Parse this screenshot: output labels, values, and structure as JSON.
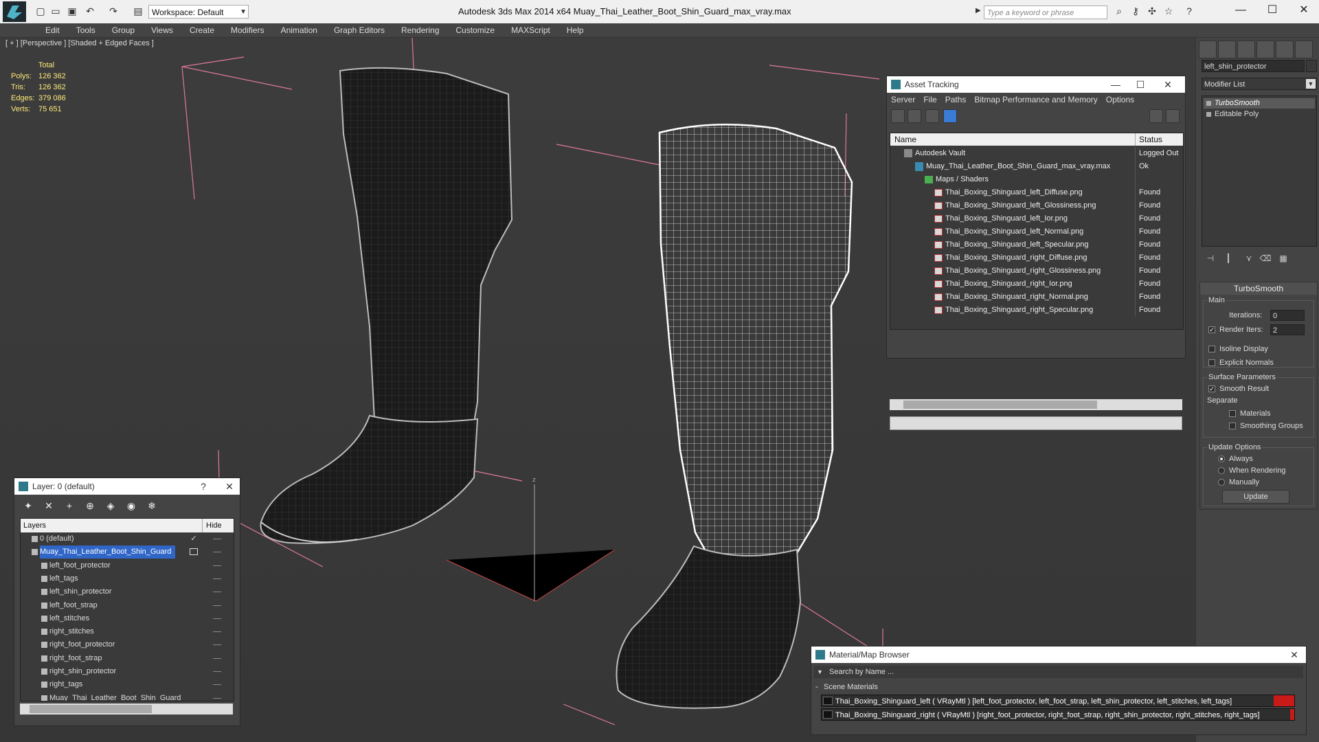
{
  "app": {
    "window_title": "Autodesk 3ds Max  2014 x64      Muay_Thai_Leather_Boot_Shin_Guard_max_vray.max",
    "workspace": "Workspace: Default",
    "search_placeholder": "Type a keyword or phrase"
  },
  "menu": [
    "Edit",
    "Tools",
    "Group",
    "Views",
    "Create",
    "Modifiers",
    "Animation",
    "Graph Editors",
    "Rendering",
    "Customize",
    "MAXScript",
    "Help"
  ],
  "viewport": {
    "label": "[ + ] [Perspective ] [Shaded + Edged Faces ]",
    "stats": {
      "header": "Total",
      "rows": [
        {
          "label": "Polys:",
          "value": "126 362"
        },
        {
          "label": "Tris:",
          "value": "126 362"
        },
        {
          "label": "Edges:",
          "value": "379 086"
        },
        {
          "label": "Verts:",
          "value": "75 651"
        }
      ]
    }
  },
  "command_panel": {
    "object_name": "left_shin_protector",
    "modifier_list": "Modifier List",
    "stack": [
      "TurboSmooth",
      "Editable Poly"
    ],
    "turbosmooth": {
      "title": "TurboSmooth",
      "main": "Main",
      "iterations_label": "Iterations:",
      "iterations": "0",
      "render_iters_label": "Render Iters:",
      "render_iters": "2",
      "isoline": "Isoline Display",
      "explicit_normals": "Explicit Normals",
      "surface_params": "Surface Parameters",
      "smooth_result": "Smooth Result",
      "separate": "Separate",
      "materials": "Materials",
      "smoothing_groups": "Smoothing Groups",
      "update_options": "Update Options",
      "always": "Always",
      "when_rendering": "When Rendering",
      "manually": "Manually",
      "update_button": "Update"
    }
  },
  "asset_tracking": {
    "title": "Asset Tracking",
    "menu": [
      "Server",
      "File",
      "Paths",
      "Bitmap Performance and Memory",
      "Options"
    ],
    "columns": [
      "Name",
      "Status"
    ],
    "rows": [
      {
        "name": "Autodesk Vault",
        "status": "Logged Out",
        "type": "vault"
      },
      {
        "name": "Muay_Thai_Leather_Boot_Shin_Guard_max_vray.max",
        "status": "Ok",
        "type": "max"
      },
      {
        "name": "Maps / Shaders",
        "status": "",
        "type": "folder"
      },
      {
        "name": "Thai_Boxing_Shinguard_left_Diffuse.png",
        "status": "Found",
        "type": "png"
      },
      {
        "name": "Thai_Boxing_Shinguard_left_Glossiness.png",
        "status": "Found",
        "type": "png"
      },
      {
        "name": "Thai_Boxing_Shinguard_left_Ior.png",
        "status": "Found",
        "type": "png"
      },
      {
        "name": "Thai_Boxing_Shinguard_left_Normal.png",
        "status": "Found",
        "type": "png"
      },
      {
        "name": "Thai_Boxing_Shinguard_left_Specular.png",
        "status": "Found",
        "type": "png"
      },
      {
        "name": "Thai_Boxing_Shinguard_right_Diffuse.png",
        "status": "Found",
        "type": "png"
      },
      {
        "name": "Thai_Boxing_Shinguard_right_Glossiness.png",
        "status": "Found",
        "type": "png"
      },
      {
        "name": "Thai_Boxing_Shinguard_right_Ior.png",
        "status": "Found",
        "type": "png"
      },
      {
        "name": "Thai_Boxing_Shinguard_right_Normal.png",
        "status": "Found",
        "type": "png"
      },
      {
        "name": "Thai_Boxing_Shinguard_right_Specular.png",
        "status": "Found",
        "type": "png"
      }
    ]
  },
  "layer_dialog": {
    "title": "Layer: 0 (default)",
    "help": "?",
    "columns": [
      "Layers",
      "Hide"
    ],
    "rows": [
      {
        "name": "0 (default)",
        "level": 0,
        "selected": false,
        "checked": true
      },
      {
        "name": "Muay_Thai_Leather_Boot_Shin_Guard",
        "level": 0,
        "selected": true,
        "checked": false
      },
      {
        "name": "left_foot_protector",
        "level": 1
      },
      {
        "name": "left_tags",
        "level": 1
      },
      {
        "name": "left_shin_protector",
        "level": 1
      },
      {
        "name": "left_foot_strap",
        "level": 1
      },
      {
        "name": "left_stitches",
        "level": 1
      },
      {
        "name": "right_stitches",
        "level": 1
      },
      {
        "name": "right_foot_protector",
        "level": 1
      },
      {
        "name": "right_foot_strap",
        "level": 1
      },
      {
        "name": "right_shin_protector",
        "level": 1
      },
      {
        "name": "right_tags",
        "level": 1
      },
      {
        "name": "Muay_Thai_Leather_Boot_Shin_Guard",
        "level": 1
      }
    ]
  },
  "material_browser": {
    "title": "Material/Map Browser",
    "search_placeholder": "Search by Name ...",
    "section": "Scene Materials",
    "materials": [
      "Thai_Boxing_Shinguard_left ( VRayMtl ) [left_foot_protector, left_foot_strap, left_shin_protector, left_stitches, left_tags]",
      "Thai_Boxing_Shinguard_right ( VRayMtl ) [right_foot_protector, right_foot_strap, right_shin_protector, right_stitches, right_tags]"
    ]
  },
  "icons": {
    "close": "✕",
    "minimize": "—",
    "maximize": "☐",
    "check": "✓"
  },
  "colors": {
    "selection": "#2f66c8",
    "stats_text": "#ffea7a",
    "material_flag": "#c91a1a"
  }
}
